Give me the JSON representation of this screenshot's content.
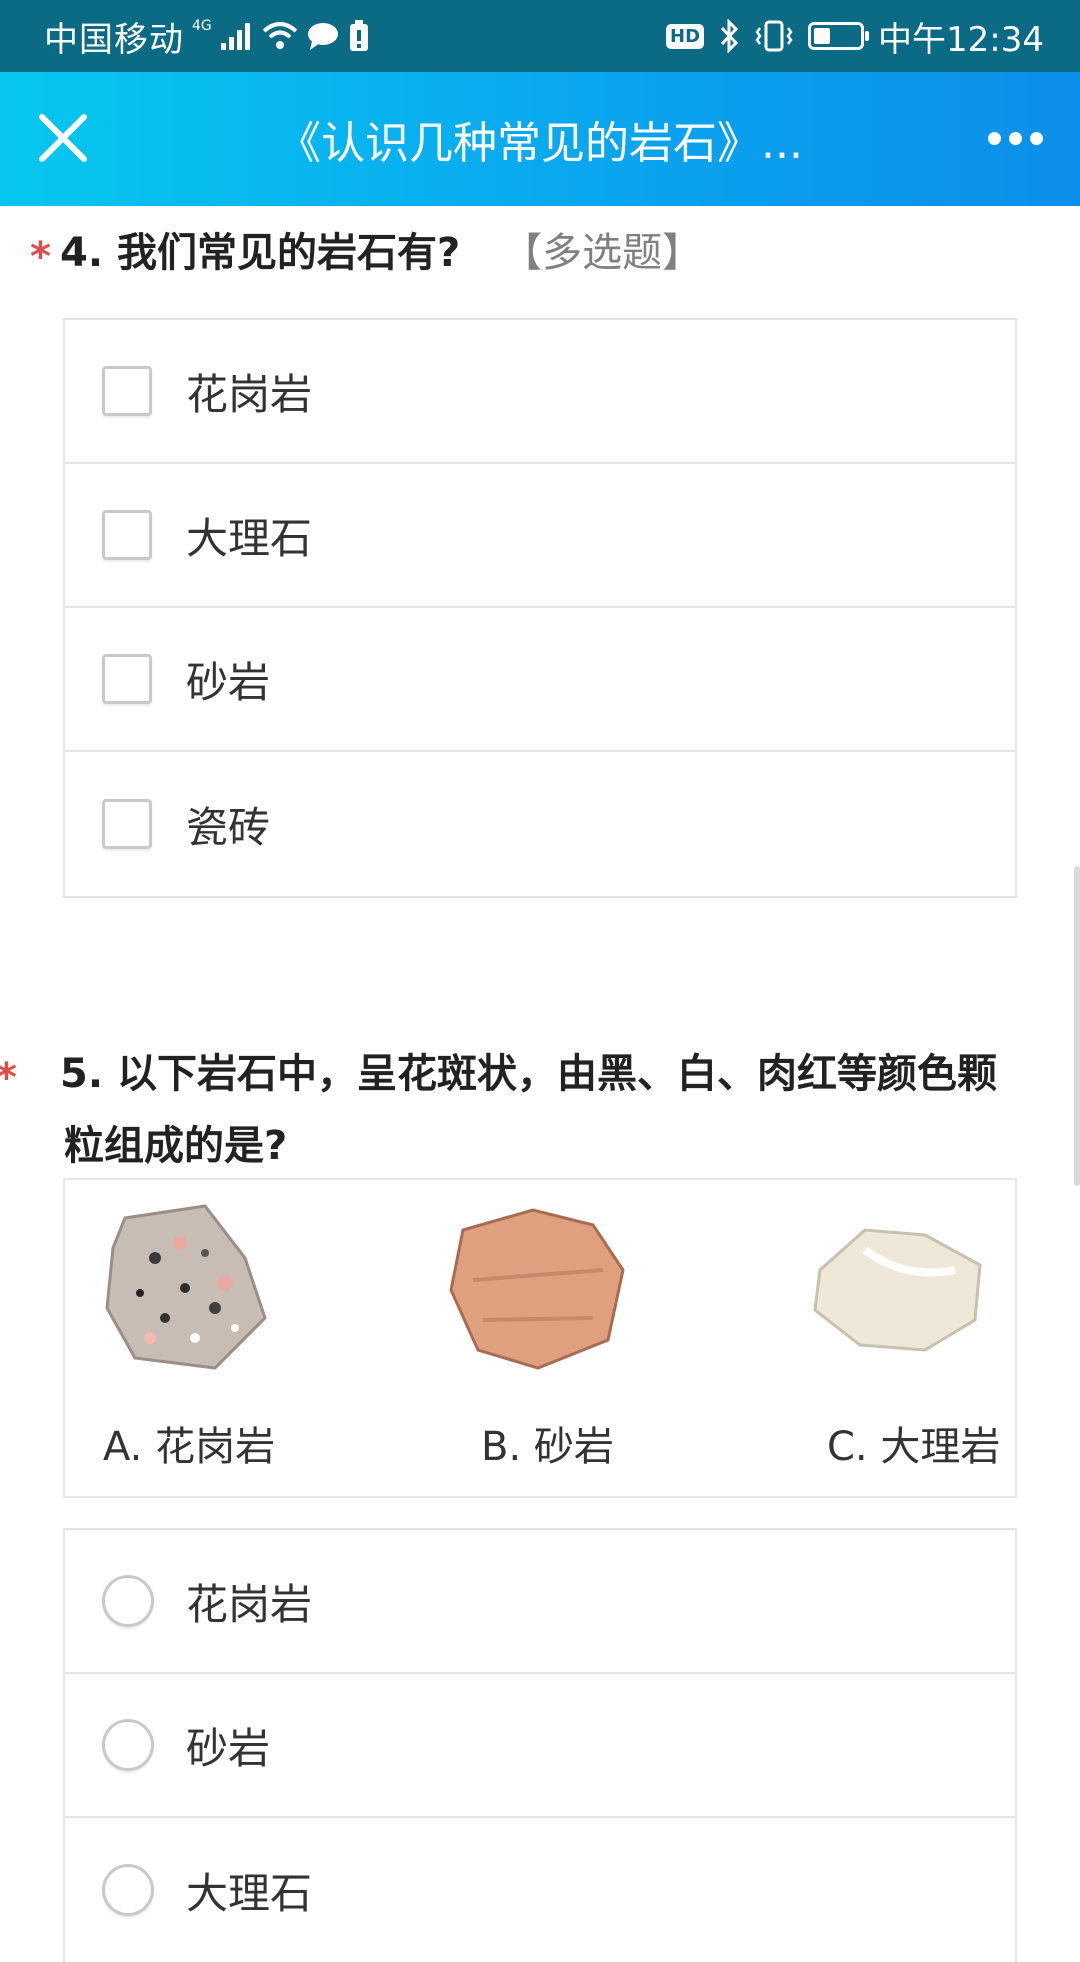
{
  "status_bar": {
    "carrier": "中国移动",
    "network": "4G",
    "hd": "HD",
    "time": "中午12:34"
  },
  "title_bar": {
    "title": "《认识几种常见的岩石》..."
  },
  "q4": {
    "required_mark": "*",
    "title": "4. 我们常见的岩石有?",
    "type": "【多选题】",
    "options": [
      "花岗岩",
      "大理石",
      "砂岩",
      "瓷砖"
    ]
  },
  "q5": {
    "required_mark": "*",
    "title": "5. 以下岩石中，呈花斑状，由黑、白、肉红等颜色颗粒组成的是?",
    "image_captions": [
      "A. 花岗岩",
      "B. 砂岩",
      "C. 大理岩"
    ],
    "options": [
      "花岗岩",
      "砂岩",
      "大理石"
    ]
  }
}
